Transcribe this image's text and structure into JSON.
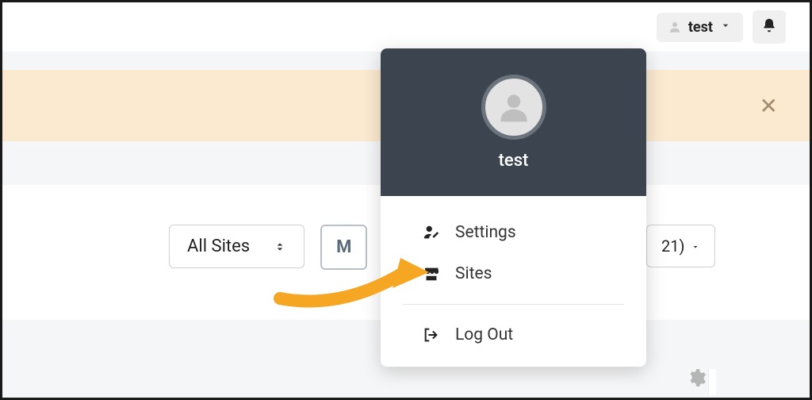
{
  "header": {
    "username": "test"
  },
  "controls": {
    "site_select": "All Sites",
    "partial_button": "M",
    "partial_right": "21)"
  },
  "dropdown": {
    "username": "test",
    "items": [
      {
        "label": "Settings"
      },
      {
        "label": "Sites"
      }
    ],
    "logout": "Log Out"
  }
}
